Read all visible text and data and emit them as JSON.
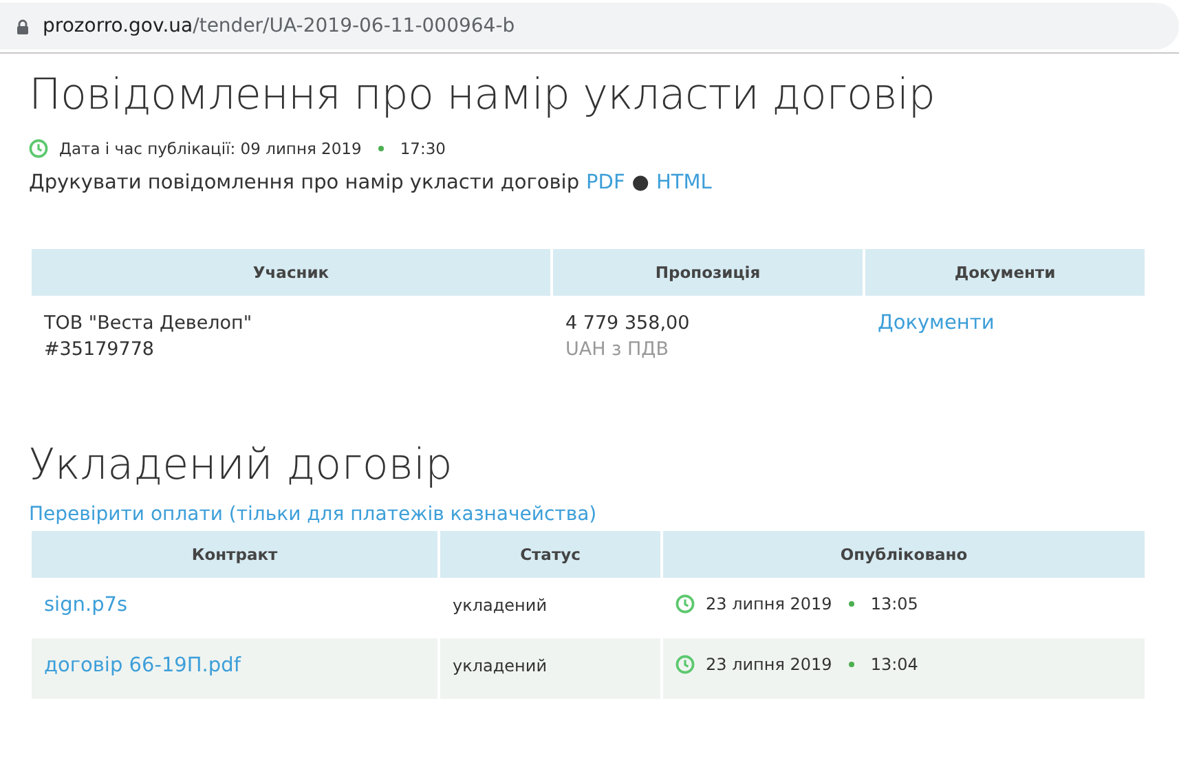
{
  "address_bar": {
    "domain": "prozorro.gov.ua",
    "path": "/tender/UA-2019-06-11-000964-b"
  },
  "title": "Повідомлення про намір укласти договір",
  "published": {
    "label": "Дата і час публікації: 09 липня 2019",
    "time": "17:30"
  },
  "print": {
    "text": "Друкувати повідомлення про намір укласти договір",
    "links": [
      "PDF",
      "HTML"
    ],
    "separator": "●"
  },
  "bids_table": {
    "columns": [
      "Учасник",
      "Пропозиція",
      "Документи"
    ],
    "rows": [
      {
        "name": "ТОВ \"Веста Девелоп\"",
        "code": "#35179778",
        "amount": "4 779 358,00",
        "currency": "UAH з ПДВ",
        "documents": "Документи"
      }
    ]
  },
  "contract_heading": "Укладений договір",
  "payments_link": "Перевірити оплати (тільки для платежів казначейства)",
  "contracts_table": {
    "columns": [
      "Контракт",
      "Статус",
      "Опубліковано"
    ],
    "rows": [
      {
        "file": "sign.p7s",
        "status": "укладений",
        "date": "23 липня 2019",
        "time": "13:05"
      },
      {
        "file": "договір 66-19П.pdf",
        "status": "укладений",
        "date": "23 липня 2019",
        "time": "13:04"
      }
    ]
  }
}
